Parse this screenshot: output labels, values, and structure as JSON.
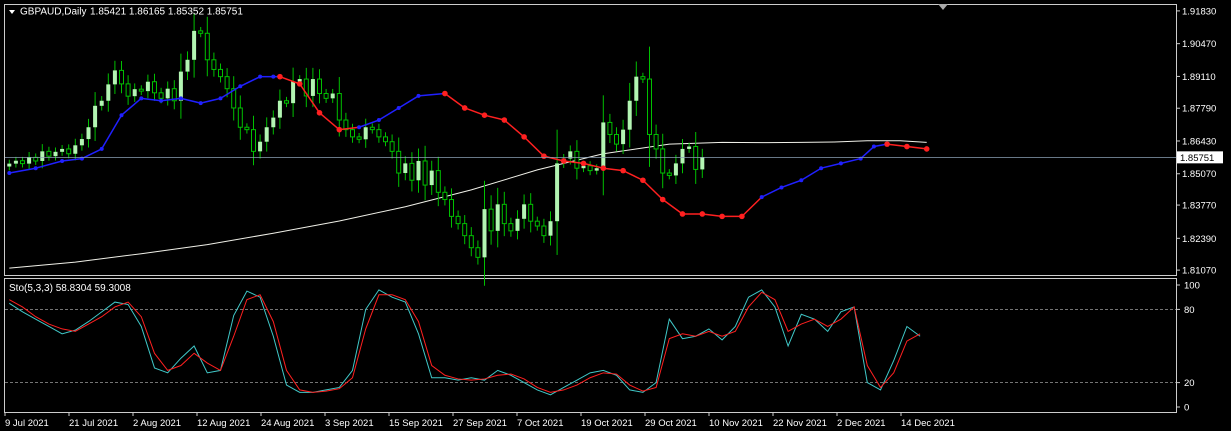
{
  "header": {
    "symbol_label": "GBPAUD,Daily",
    "ohlc": "1.85421 1.86165 1.85352 1.85751"
  },
  "price_axis": {
    "ticks": [
      "1.91830",
      "1.90470",
      "1.89110",
      "1.87790",
      "1.86430",
      "1.85070",
      "1.83770",
      "1.82390",
      "1.81070"
    ],
    "current_price": "1.85751"
  },
  "oscillator": {
    "label": "Sto(5,3,3) 58.8304 59.3008",
    "levels": [
      "100",
      "80",
      "20",
      "0"
    ]
  },
  "time_axis": {
    "labels": [
      "9 Jul 2021",
      "21 Jul 2021",
      "2 Aug 2021",
      "12 Aug 2021",
      "24 Aug 2021",
      "3 Sep 2021",
      "15 Sep 2021",
      "27 Sep 2021",
      "7 Oct 2021",
      "19 Oct 2021",
      "29 Oct 2021",
      "10 Nov 2021",
      "22 Nov 2021",
      "2 Dec 2021",
      "14 Dec 2021"
    ]
  },
  "colors": {
    "background": "#000000",
    "bull_candle": "#b3f5b3",
    "wick": "#00c000",
    "trail_up": "#2020ff",
    "trail_down": "#ff2020",
    "ma": "#f0f0e8",
    "stoch_main": "#40c8c8",
    "stoch_signal": "#ff2020",
    "price_line": "#8aa0b4",
    "frame": "#cccccc"
  },
  "chart_data": [
    {
      "type": "candlestick",
      "symbol": "GBPAUD",
      "timeframe": "Daily",
      "ylim": [
        1.8095,
        1.9195
      ],
      "x_start": "2021-07-05",
      "last_bar": "2021-12-17",
      "close": [
        1.8549,
        1.8561,
        1.8549,
        1.8575,
        1.856,
        1.86,
        1.858,
        1.8598,
        1.861,
        1.859,
        1.8625,
        1.8651,
        1.87,
        1.8789,
        1.881,
        1.8878,
        1.8936,
        1.888,
        1.8829,
        1.8858,
        1.885,
        1.8889,
        1.8843,
        1.882,
        1.886,
        1.881,
        1.8931,
        1.898,
        1.91,
        1.909,
        1.898,
        1.894,
        1.891,
        1.886,
        1.878,
        1.87,
        1.869,
        1.86,
        1.864,
        1.87,
        1.874,
        1.881,
        1.88,
        1.889,
        1.89,
        1.883,
        1.89,
        1.884,
        1.882,
        1.884,
        1.873,
        1.869,
        1.866,
        1.865,
        1.87,
        1.869,
        1.866,
        1.864,
        1.86,
        1.851,
        1.855,
        1.848,
        1.856,
        1.846,
        1.852,
        1.843,
        1.84,
        1.833,
        1.83,
        1.825,
        1.82,
        1.816,
        1.836,
        1.827,
        1.838,
        1.83,
        1.827,
        1.832,
        1.838,
        1.831,
        1.829,
        1.825,
        1.831,
        1.855,
        1.857,
        1.86,
        1.853,
        1.854,
        1.852,
        1.853,
        1.872,
        1.867,
        1.863,
        1.869,
        1.881,
        1.891,
        1.89,
        1.867,
        1.861,
        1.851,
        1.85,
        1.855,
        1.861,
        1.862,
        1.8525,
        1.8575
      ],
      "trailing_stop": {
        "dots": [
          [
            0,
            1.851,
            "up"
          ],
          [
            4,
            1.853,
            "up"
          ],
          [
            8,
            1.856,
            "up"
          ],
          [
            11,
            1.857,
            "up"
          ],
          [
            14,
            1.861,
            "up"
          ],
          [
            17,
            1.875,
            "up"
          ],
          [
            20,
            1.882,
            "up"
          ],
          [
            23,
            1.881,
            "up"
          ],
          [
            26,
            1.882,
            "up"
          ],
          [
            29,
            1.88,
            "up"
          ],
          [
            32,
            1.882,
            "up"
          ],
          [
            35,
            1.887,
            "up"
          ],
          [
            38,
            1.891,
            "up"
          ],
          [
            40,
            1.891,
            "up"
          ],
          [
            41,
            1.891,
            "down"
          ],
          [
            44,
            1.888,
            "down"
          ],
          [
            47,
            1.876,
            "down"
          ],
          [
            50,
            1.869,
            "down"
          ],
          [
            53,
            1.87,
            "up"
          ],
          [
            56,
            1.873,
            "up"
          ],
          [
            59,
            1.878,
            "up"
          ],
          [
            62,
            1.883,
            "up"
          ],
          [
            66,
            1.884,
            "down"
          ],
          [
            69,
            1.878,
            "down"
          ],
          [
            72,
            1.875,
            "down"
          ],
          [
            75,
            1.873,
            "down"
          ],
          [
            78,
            1.866,
            "down"
          ],
          [
            81,
            1.858,
            "down"
          ],
          [
            84,
            1.856,
            "down"
          ],
          [
            87,
            1.855,
            "down"
          ],
          [
            90,
            1.853,
            "down"
          ],
          [
            93,
            1.852,
            "down"
          ],
          [
            96,
            1.848,
            "down"
          ],
          [
            99,
            1.84,
            "down"
          ],
          [
            102,
            1.834,
            "down"
          ],
          [
            105,
            1.834,
            "down"
          ],
          [
            108,
            1.833,
            "down"
          ],
          [
            111,
            1.833,
            "down"
          ],
          [
            114,
            1.841,
            "up"
          ],
          [
            117,
            1.845,
            "up"
          ],
          [
            120,
            1.848,
            "up"
          ],
          [
            123,
            1.853,
            "up"
          ],
          [
            126,
            1.855,
            "up"
          ],
          [
            129,
            1.857,
            "up"
          ],
          [
            131,
            1.862,
            "up"
          ],
          [
            133,
            1.863,
            "down"
          ],
          [
            136,
            1.862,
            "down"
          ],
          [
            139,
            1.861,
            "down"
          ]
        ]
      },
      "moving_average": [
        [
          0,
          1.8115
        ],
        [
          10,
          1.814
        ],
        [
          20,
          1.8175
        ],
        [
          30,
          1.8213
        ],
        [
          40,
          1.826
        ],
        [
          50,
          1.8311
        ],
        [
          60,
          1.837
        ],
        [
          70,
          1.844
        ],
        [
          80,
          1.8523
        ],
        [
          90,
          1.859
        ],
        [
          100,
          1.863
        ],
        [
          108,
          1.8637
        ],
        [
          115,
          1.8636
        ],
        [
          120,
          1.8637
        ],
        [
          125,
          1.8639
        ],
        [
          130,
          1.8644
        ],
        [
          135,
          1.8644
        ],
        [
          139,
          1.8637
        ]
      ]
    },
    {
      "type": "line",
      "name": "Sto(5,3,3)",
      "ylim": [
        0,
        100
      ],
      "levels": [
        80,
        20
      ],
      "series": [
        {
          "name": "main",
          "x": [
            0,
            2,
            4,
            6,
            8,
            10,
            12,
            14,
            16,
            18,
            20,
            22,
            24,
            26,
            28,
            30,
            32,
            34,
            36,
            38,
            40,
            42,
            44,
            46,
            48,
            50,
            52,
            54,
            56,
            58,
            60,
            62,
            64,
            66,
            68,
            70,
            72,
            74,
            76,
            78,
            80,
            82,
            84,
            86,
            88,
            90,
            92,
            94,
            96,
            98,
            100,
            102,
            104,
            106,
            108,
            110,
            112,
            114,
            116,
            118,
            120,
            122,
            124,
            126,
            128,
            130,
            132,
            134,
            136,
            138
          ],
          "values": [
            85,
            78,
            72,
            66,
            60,
            63,
            70,
            78,
            86,
            84,
            66,
            32,
            28,
            40,
            50,
            28,
            30,
            75,
            95,
            90,
            58,
            18,
            12,
            12,
            14,
            16,
            30,
            80,
            96,
            90,
            86,
            60,
            24,
            24,
            22,
            24,
            22,
            30,
            26,
            20,
            14,
            10,
            16,
            22,
            28,
            30,
            26,
            14,
            12,
            20,
            72,
            56,
            58,
            64,
            55,
            66,
            90,
            96,
            82,
            50,
            76,
            72,
            62,
            78,
            82,
            20,
            14,
            38,
            66,
            58
          ]
        },
        {
          "name": "signal",
          "x": [
            0,
            2,
            4,
            6,
            8,
            10,
            12,
            14,
            16,
            18,
            20,
            22,
            24,
            26,
            28,
            30,
            32,
            34,
            36,
            38,
            40,
            42,
            44,
            46,
            48,
            50,
            52,
            54,
            56,
            58,
            60,
            62,
            64,
            66,
            68,
            70,
            72,
            74,
            76,
            78,
            80,
            82,
            84,
            86,
            88,
            90,
            92,
            94,
            96,
            98,
            100,
            102,
            104,
            106,
            108,
            110,
            112,
            114,
            116,
            118,
            120,
            122,
            124,
            126,
            128,
            130,
            132,
            134,
            136,
            138
          ],
          "values": [
            88,
            82,
            74,
            68,
            64,
            62,
            68,
            74,
            82,
            86,
            74,
            44,
            30,
            34,
            44,
            36,
            30,
            58,
            88,
            92,
            70,
            30,
            14,
            12,
            13,
            15,
            24,
            64,
            92,
            92,
            88,
            70,
            34,
            26,
            23,
            22,
            23,
            26,
            27,
            23,
            16,
            12,
            14,
            18,
            24,
            28,
            27,
            18,
            13,
            16,
            56,
            60,
            58,
            62,
            58,
            62,
            82,
            94,
            88,
            62,
            68,
            72,
            66,
            72,
            82,
            34,
            16,
            28,
            54,
            60
          ]
        }
      ]
    }
  ]
}
